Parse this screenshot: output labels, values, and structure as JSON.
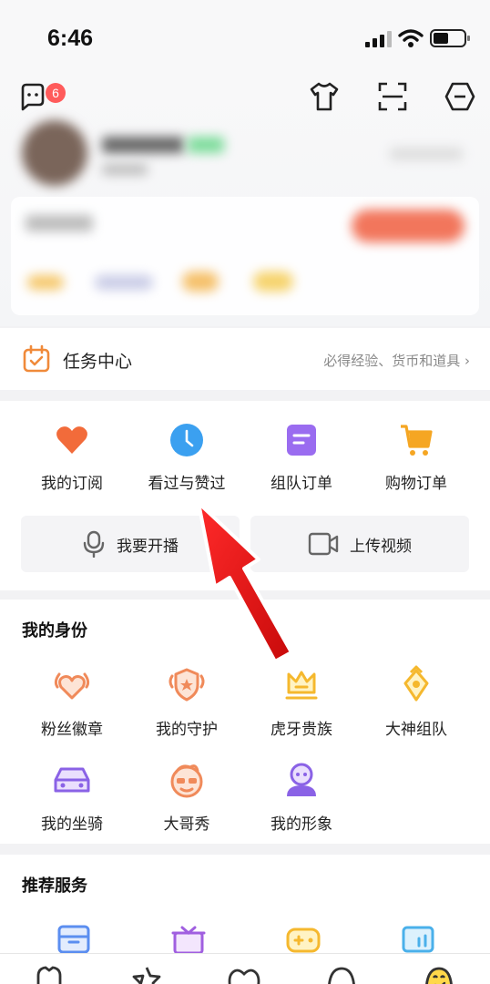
{
  "status": {
    "time": "6:46"
  },
  "header": {
    "message_badge": "6"
  },
  "task_center": {
    "title": "任务中心",
    "hint": "必得经验、货币和道具 ›"
  },
  "features": [
    {
      "label": "我的订阅",
      "icon": "heart-icon",
      "color": "#f26b3a"
    },
    {
      "label": "看过与赞过",
      "icon": "clock-icon",
      "color": "#3ba0f0"
    },
    {
      "label": "组队订单",
      "icon": "order-icon",
      "color": "#9a6cf0"
    },
    {
      "label": "购物订单",
      "icon": "cart-icon",
      "color": "#f5a623"
    }
  ],
  "actions": {
    "broadcast": "我要开播",
    "upload": "上传视频"
  },
  "identity": {
    "title": "我的身份",
    "items": [
      {
        "label": "粉丝徽章",
        "icon": "fan-badge-icon"
      },
      {
        "label": "我的守护",
        "icon": "guard-icon"
      },
      {
        "label": "虎牙贵族",
        "icon": "crown-icon"
      },
      {
        "label": "大神组队",
        "icon": "team-icon"
      },
      {
        "label": "我的坐骑",
        "icon": "car-icon"
      },
      {
        "label": "大哥秀",
        "icon": "face-icon"
      },
      {
        "label": "我的形象",
        "icon": "avatar-icon"
      }
    ]
  },
  "recommend": {
    "title": "推荐服务"
  }
}
